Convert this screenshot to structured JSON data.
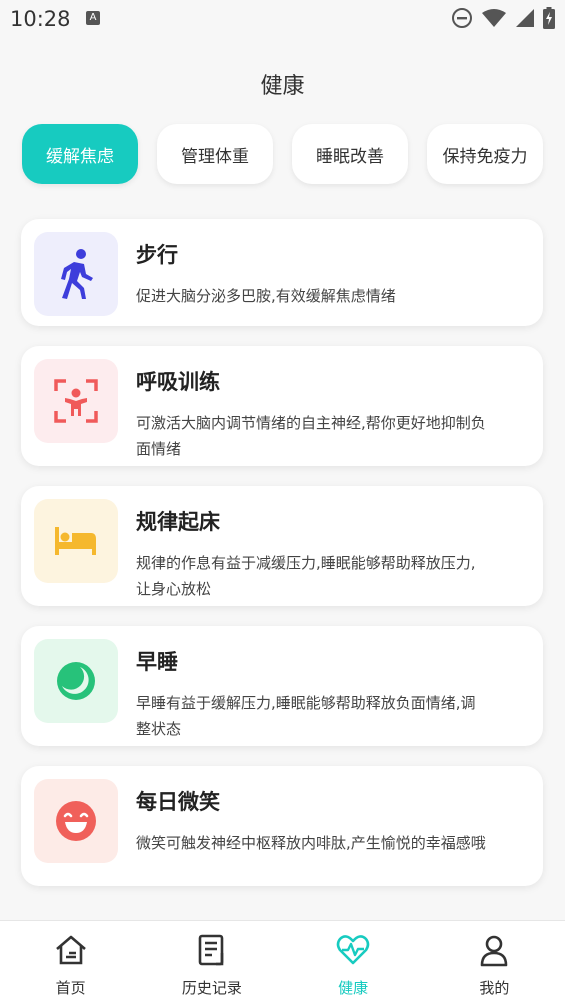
{
  "status_bar": {
    "time": "10:28",
    "notification_badge": "A"
  },
  "page_title": "健康",
  "categories": [
    {
      "label": "缓解焦虑",
      "active": true
    },
    {
      "label": "管理体重",
      "active": false
    },
    {
      "label": "睡眠改善",
      "active": false
    },
    {
      "label": "保持免疫力",
      "active": false
    }
  ],
  "cards": [
    {
      "title": "步行",
      "desc": "促进大脑分泌多巴胺,有效缓解焦虑情绪",
      "icon": "walking-icon",
      "icon_color": "#3d3ddb",
      "bg": "#eeeefc"
    },
    {
      "title": "呼吸训练",
      "desc": "可激活大脑内调节情绪的自主神经,帮你更好地抑制负面情绪",
      "icon": "breathing-icon",
      "icon_color": "#f05a5a",
      "bg": "#fdecee"
    },
    {
      "title": "规律起床",
      "desc": "规律的作息有益于减缓压力,睡眠能够帮助释放压力,让身心放松",
      "icon": "bed-icon",
      "icon_color": "#f5b82e",
      "bg": "#fdf4df"
    },
    {
      "title": "早睡",
      "desc": "早睡有益于缓解压力,睡眠能够帮助释放负面情绪,调整状态",
      "icon": "moon-icon",
      "icon_color": "#27c27a",
      "bg": "#e4f8ec"
    },
    {
      "title": "每日微笑",
      "desc": "微笑可触发神经中枢释放内啡肽,产生愉悦的幸福感哦",
      "icon": "smile-icon",
      "icon_color": "#f0605a",
      "bg": "#fdebe7"
    }
  ],
  "tabbar": [
    {
      "label": "首页",
      "icon": "home-icon",
      "active": false
    },
    {
      "label": "历史记录",
      "icon": "history-icon",
      "active": false
    },
    {
      "label": "健康",
      "icon": "heart-pulse-icon",
      "active": true
    },
    {
      "label": "我的",
      "icon": "profile-icon",
      "active": false
    }
  ],
  "accent_color": "#17cbc0"
}
